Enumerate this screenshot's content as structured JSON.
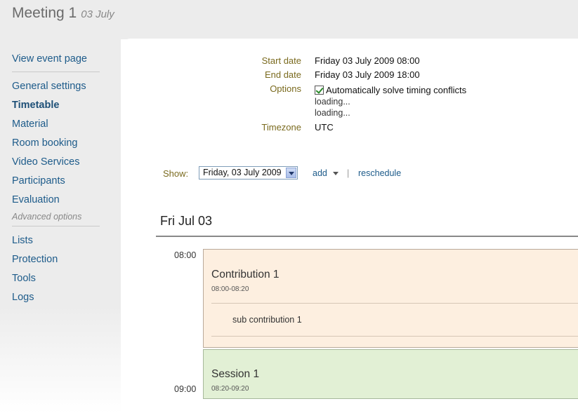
{
  "header": {
    "title": "Meeting 1",
    "date": "03 July"
  },
  "sidebar": {
    "view_event": "View event page",
    "items": [
      {
        "label": "General settings"
      },
      {
        "label": "Timetable"
      },
      {
        "label": "Material"
      },
      {
        "label": "Room booking"
      },
      {
        "label": "Video Services"
      },
      {
        "label": "Participants"
      },
      {
        "label": "Evaluation"
      }
    ],
    "advanced_label": "Advanced options",
    "advanced_items": [
      {
        "label": "Lists"
      },
      {
        "label": "Protection"
      },
      {
        "label": "Tools"
      },
      {
        "label": "Logs"
      }
    ],
    "active": "Timetable"
  },
  "info": {
    "start_label": "Start date",
    "start_value": "Friday 03 July 2009 08:00",
    "end_label": "End date",
    "end_value": "Friday 03 July 2009 18:00",
    "options_label": "Options",
    "options_checkbox": "Automatically solve timing conflicts",
    "loading_1": "loading...",
    "loading_2": "loading...",
    "timezone_label": "Timezone",
    "timezone_value": "UTC"
  },
  "toolbar": {
    "show_label": "Show:",
    "show_value": "Friday, 03 July 2009",
    "add_label": "add",
    "separator": "|",
    "reschedule_label": "reschedule"
  },
  "timetable": {
    "day_title": "Fri Jul 03",
    "hours": [
      "08:00",
      "09:00"
    ],
    "contribution": {
      "title": "Contribution 1",
      "time": "08:00-08:20",
      "sub": "sub contribution 1"
    },
    "session": {
      "title": "Session 1",
      "time": "08:20-09:20"
    }
  }
}
